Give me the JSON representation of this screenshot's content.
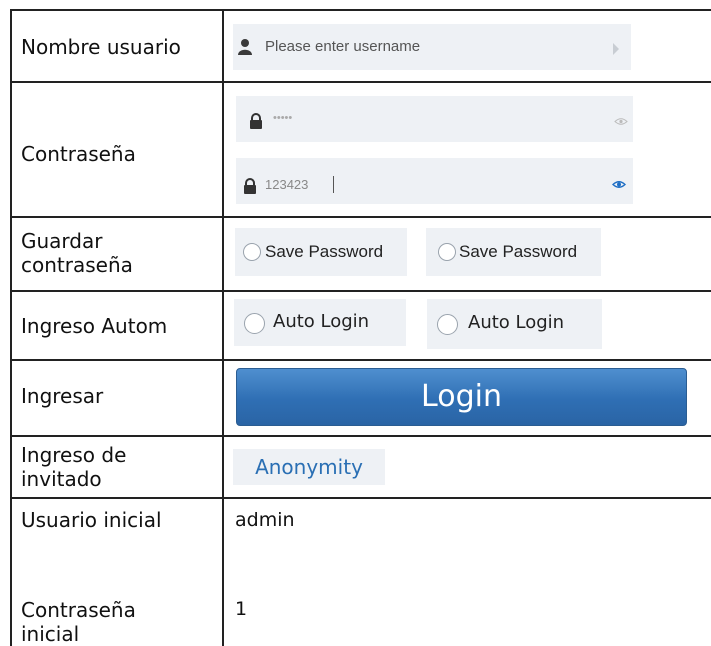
{
  "rows": {
    "username": {
      "label": "Nombre usuario",
      "placeholder": "Please enter username"
    },
    "password": {
      "label": "Contraseña",
      "masked_value": "•••••",
      "visible_value": "123423"
    },
    "save_password": {
      "label_line1": "Guardar",
      "label_line2": "contraseña",
      "option_a": "Save Password",
      "option_b": "Save Password"
    },
    "auto_login": {
      "label": "Ingreso Autom",
      "option_a": "Auto Login",
      "option_b": "Auto Login"
    },
    "login": {
      "label": "Ingresar",
      "button": "Login"
    },
    "guest": {
      "label_line1": "Ingreso de",
      "label_line2": "invitado",
      "button": "Anonymity"
    },
    "initial_user": {
      "label": "Usuario inicial",
      "value": "admin"
    },
    "initial_password": {
      "label_line1": "Contraseña",
      "label_line2": "inicial",
      "value": "1"
    }
  },
  "icons": [
    "user-icon",
    "arrow-right-icon",
    "lock-icon",
    "eye-icon"
  ],
  "colors": {
    "login_button": "#2f6fb4",
    "anonymity_text": "#2a6fb4",
    "field_bg": "#eef1f5",
    "eye_active": "#1f6fc5"
  }
}
